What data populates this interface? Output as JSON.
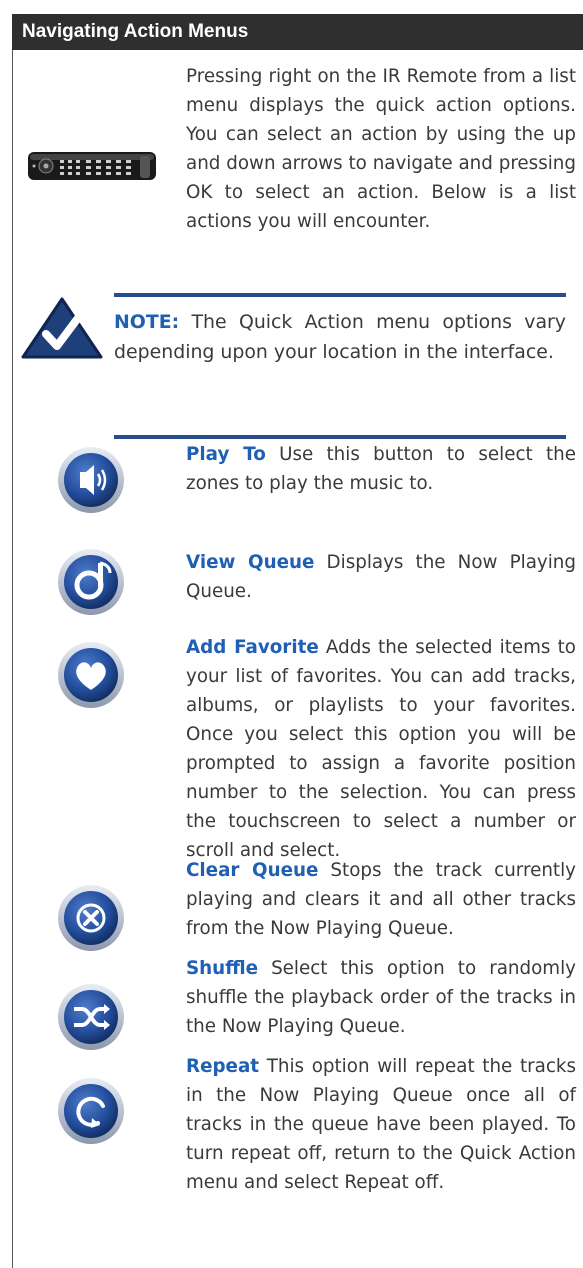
{
  "header": {
    "title": "Navigating Action Menus"
  },
  "intro": {
    "text": "Pressing right on the IR Remote from a list menu displays the quick action options. You can select an action by using the up and down arrows to navigate and pressing OK to select an action. Below is a list actions you will encounter.",
    "icon": "ir-remote"
  },
  "note": {
    "label": "NOTE:",
    "text": " The Quick Action menu options vary depending upon your location in the interface.",
    "icon": "checkmark-triangle"
  },
  "actions": [
    {
      "title": "Play To",
      "text": " Use this button to select the zones to play the music to.",
      "icon": "play-to"
    },
    {
      "title": "View Queue",
      "text": "  Displays the Now Playing Queue.",
      "icon": "view-queue"
    },
    {
      "title": "Add Favorite",
      "text": " Adds the selected items to your list of favorites. You can add tracks, albums, or playlists to your favorites. Once you select this option you will be prompted to assign a favorite position number to the selection. You can press the touchscreen to select a number or scroll and select.",
      "icon": "heart"
    },
    {
      "title": "Clear Queue",
      "text": "  Stops the track currently playing and clears it and all other tracks from the Now Playing Queue.",
      "icon": "clear"
    },
    {
      "title": "Shuffle",
      "text": "  Select this option to randomly shuffle the playback order of the tracks in the Now Playing Queue.",
      "icon": "shuffle"
    },
    {
      "title": "Repeat",
      "text": " This option will repeat the tracks in the Now Playing Queue once all of tracks in the queue have been played. To turn repeat off, return to the Quick Action menu and select Repeat off.",
      "icon": "repeat"
    }
  ],
  "colors": {
    "header_bg": "#2f2f2f",
    "accent": "#1f5fb4",
    "rule": "#274d8c"
  }
}
